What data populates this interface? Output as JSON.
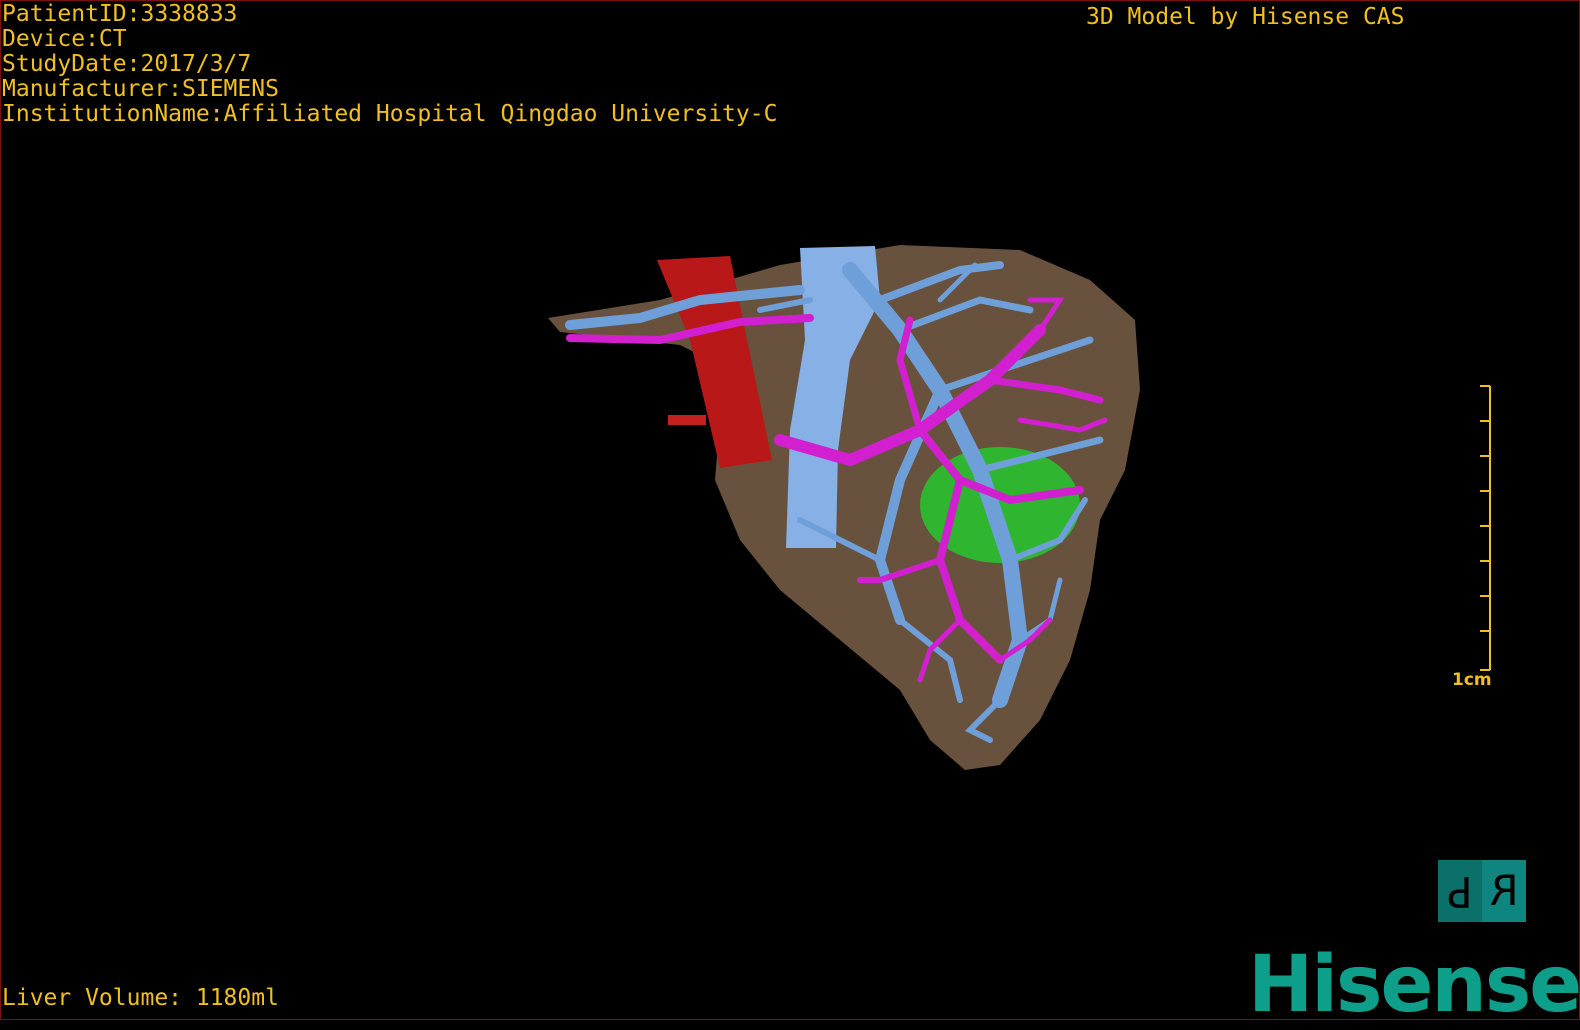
{
  "overlay": {
    "patient_id": "PatientID:3338833",
    "device": "Device:CT",
    "study_date": "StudyDate:2017/3/7",
    "manufacturer": "Manufacturer:SIEMENS",
    "institution": "InstitutionName:Affiliated Hospital Qingdao University-C",
    "credit": "3D Model by Hisense CAS",
    "liver_volume": "Liver Volume: 1180ml"
  },
  "scale_bar": {
    "label": "1cm"
  },
  "orientation": {
    "left": "P",
    "right": "R"
  },
  "brand": {
    "name": "Hisense",
    "color": "#0e9f8a"
  },
  "colors": {
    "text": "#f0c020",
    "liver": "#7a6145",
    "portal_vein": "#6f9fd8",
    "hepatic_vein": "#d21fd0",
    "artery": "#b81818",
    "lesion": "#2fb52f",
    "background": "#000000"
  }
}
